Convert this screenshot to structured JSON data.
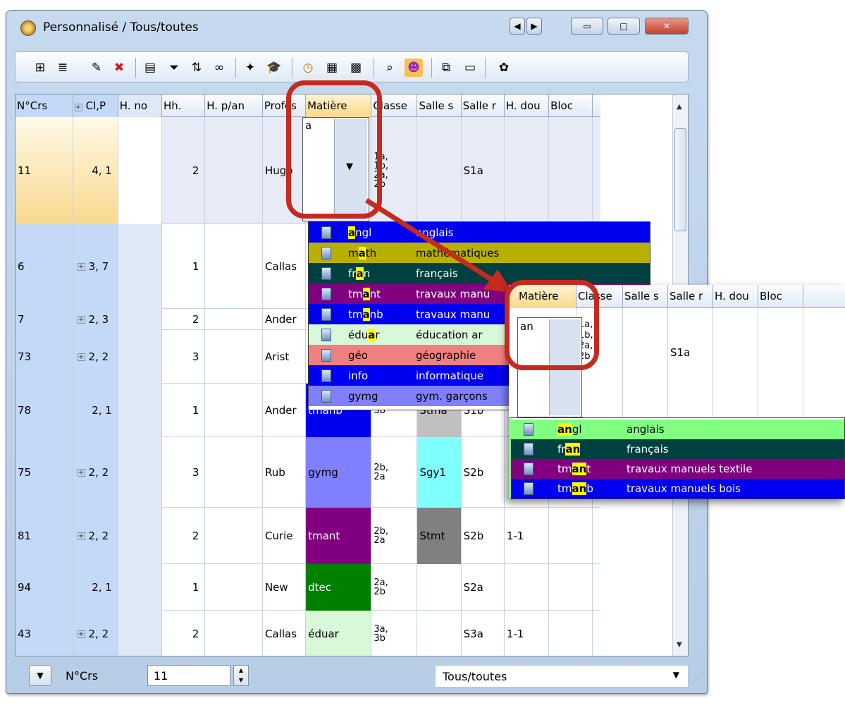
{
  "window": {
    "title": "Personnalisé / Tous/toutes",
    "nav_prev": "◀",
    "nav_next": "▶",
    "minimize": "▭",
    "maximize": "□",
    "close": "✕"
  },
  "toolbar": {
    "icons": [
      "grid-expand-icon",
      "rows-icon",
      "new-icon",
      "delete-icon",
      "list-edit-icon",
      "filter-icon",
      "sort-icon",
      "link-icon",
      "wand-icon",
      "graduation-icon",
      "clock-icon",
      "calendar-icon",
      "matrix-icon",
      "search-window-icon",
      "people-icon",
      "copy-window-icon",
      "window-icon",
      "palette-icon"
    ]
  },
  "colors": {
    "selected_row_bg": "#fbe7b0",
    "highlight": "#ffff00",
    "ring": "#c62a1f"
  },
  "grid": {
    "columns": [
      "N°Crs",
      "Cl,P",
      "H. no",
      "Hh.",
      "H. p/an",
      "Profes",
      "Matière",
      "Classe",
      "Salle s",
      "Salle r",
      "H. dou",
      "Bloc"
    ],
    "rows": [
      {
        "ncrs": "11",
        "cl": "4, 1",
        "has_plus": false,
        "hh": "2",
        "prof": "Hugo",
        "mat": "",
        "mat_color": "",
        "classe": "1a,\n1b,\n2a,\n2b",
        "salle_s": "",
        "salle_s_color": "",
        "salle_r": "S1a",
        "hdou": ""
      },
      {
        "ncrs": "6",
        "cl": "3, 7",
        "has_plus": true,
        "hh": "1",
        "prof": "Callas",
        "mat": "",
        "mat_color": "",
        "classe": "",
        "salle_s": "",
        "salle_s_color": "",
        "salle_r": "",
        "hdou": ""
      },
      {
        "ncrs": "7",
        "cl": "2, 3",
        "has_plus": true,
        "hh": "2",
        "prof": "Ander",
        "mat": "",
        "mat_color": "",
        "classe": "",
        "salle_s": "",
        "salle_s_color": "",
        "salle_r": "",
        "hdou": ""
      },
      {
        "ncrs": "73",
        "cl": "2, 2",
        "has_plus": true,
        "hh": "3",
        "prof": "Arist",
        "mat": "",
        "mat_color": "",
        "classe": "",
        "salle_s": "",
        "salle_s_color": "",
        "salle_r": "",
        "hdou": ""
      },
      {
        "ncrs": "78",
        "cl": "2, 1",
        "has_plus": false,
        "hh": "1",
        "prof": "Ander",
        "mat": "tmanb",
        "mat_color": "#0000f0",
        "classe": "3b",
        "salle_s": "Stma",
        "salle_s_color": "#c0c0c0",
        "salle_r": "S1b",
        "hdou": ""
      },
      {
        "ncrs": "75",
        "cl": "2, 2",
        "has_plus": true,
        "hh": "3",
        "prof": "Rub",
        "mat": "gymg",
        "mat_color": "#8080ff",
        "classe": "2b,\n2a",
        "salle_s": "Sgy1",
        "salle_s_color": "#80ffff",
        "salle_r": "S2b",
        "hdou": ""
      },
      {
        "ncrs": "81",
        "cl": "2, 2",
        "has_plus": true,
        "hh": "2",
        "prof": "Curie",
        "mat": "tmant",
        "mat_color": "#800080",
        "classe": "2b,\n2a",
        "salle_s": "Stmt",
        "salle_s_color": "#808080",
        "salle_r": "S2b",
        "hdou": "1-1"
      },
      {
        "ncrs": "94",
        "cl": "2, 1",
        "has_plus": false,
        "hh": "1",
        "prof": "New",
        "mat": "dtec",
        "mat_color": "#008000",
        "classe": "2a,\n2b",
        "salle_s": "",
        "salle_s_color": "",
        "salle_r": "S2a",
        "hdou": ""
      },
      {
        "ncrs": "43",
        "cl": "2, 2",
        "has_plus": true,
        "hh": "2",
        "prof": "Callas",
        "mat": "éduar",
        "mat_color": "#d8f8d8",
        "classe": "3a,\n3b",
        "salle_s": "",
        "salle_s_color": "",
        "salle_r": "S3a",
        "hdou": "1-1"
      }
    ]
  },
  "editor_a": {
    "value": "a",
    "arrow": "▼"
  },
  "dropdown_a": {
    "items": [
      {
        "pre": "",
        "hl": "a",
        "post": "ngl",
        "name_pre": "an",
        "name_hl": "g",
        "name_post": "lais",
        "bg": "#0000f0",
        "fg": "#ffffff",
        "name": "anglais"
      },
      {
        "pre": "m",
        "hl": "a",
        "post": "th",
        "name": "mathématiques",
        "bg": "#b8b000",
        "fg": "#000000"
      },
      {
        "pre": "fr",
        "hl": "a",
        "post": "n",
        "name": "français",
        "bg": "#004040",
        "fg": "#ffffff"
      },
      {
        "pre": "tm",
        "hl": "a",
        "post": "nt",
        "name": "travaux manu",
        "bg": "#800080",
        "fg": "#ffffff"
      },
      {
        "pre": "tm",
        "hl": "a",
        "post": "nb",
        "name": "travaux manu",
        "bg": "#0000f0",
        "fg": "#ffffff"
      },
      {
        "pre": "édu",
        "hl": "a",
        "post": "r",
        "name": "éducation ar",
        "bg": "#d8f8d8",
        "fg": "#000000"
      },
      {
        "pre": "géo",
        "hl": "",
        "post": "",
        "name": "géographie",
        "bg": "#f08080",
        "fg": "#000000"
      },
      {
        "pre": "info",
        "hl": "",
        "post": "",
        "name": "informatique",
        "bg": "#0000f0",
        "fg": "#ffffff"
      },
      {
        "pre": "gymg",
        "hl": "",
        "post": "",
        "name": "gym. garçons",
        "bg": "#8080ff",
        "fg": "#000000"
      }
    ]
  },
  "zoom": {
    "columns": [
      "Matière",
      "Classe",
      "Salle s",
      "Salle r",
      "H. dou",
      "Bloc"
    ],
    "editor_value": "an",
    "classe": "1a,\n1b,\n2a,\n2b",
    "salle_r": "S1a",
    "items": [
      {
        "pre": "",
        "hl": "an",
        "post": "gl",
        "name": "anglais",
        "bg": "#80ff80",
        "fg": "#000000"
      },
      {
        "pre": "fr",
        "hl": "an",
        "post": "",
        "name": "français",
        "bg": "#004040",
        "fg": "#ffffff"
      },
      {
        "pre": "tm",
        "hl": "an",
        "post": "t",
        "name": "travaux manuels textile",
        "bg": "#800080",
        "fg": "#ffffff"
      },
      {
        "pre": "tm",
        "hl": "an",
        "post": "b",
        "name": "travaux manuels bois",
        "bg": "#0000f0",
        "fg": "#ffffff"
      }
    ]
  },
  "statusbar": {
    "label": "N°Crs",
    "input_value": "11",
    "select_value": "Tous/toutes"
  }
}
